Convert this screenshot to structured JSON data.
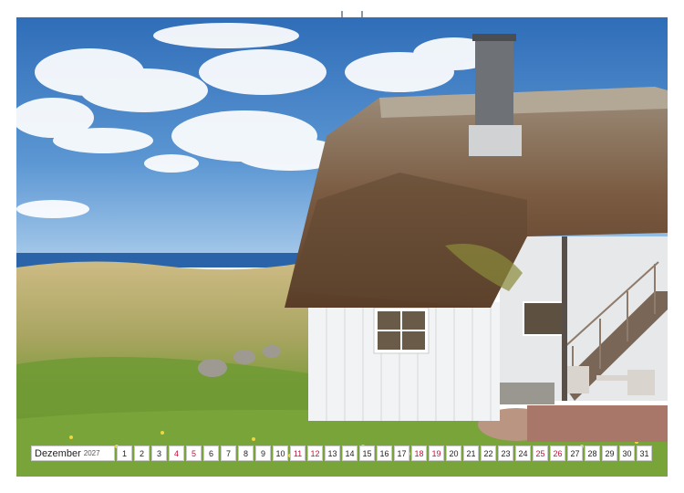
{
  "calendar": {
    "month": "Dezember",
    "year": "2027",
    "days": [
      {
        "n": "1",
        "weekend": false
      },
      {
        "n": "2",
        "weekend": false
      },
      {
        "n": "3",
        "weekend": false
      },
      {
        "n": "4",
        "weekend": true
      },
      {
        "n": "5",
        "weekend": true
      },
      {
        "n": "6",
        "weekend": false
      },
      {
        "n": "7",
        "weekend": false
      },
      {
        "n": "8",
        "weekend": false
      },
      {
        "n": "9",
        "weekend": false
      },
      {
        "n": "10",
        "weekend": false
      },
      {
        "n": "11",
        "weekend": true
      },
      {
        "n": "12",
        "weekend": true
      },
      {
        "n": "13",
        "weekend": false
      },
      {
        "n": "14",
        "weekend": false
      },
      {
        "n": "15",
        "weekend": false
      },
      {
        "n": "16",
        "weekend": false
      },
      {
        "n": "17",
        "weekend": false
      },
      {
        "n": "18",
        "weekend": true
      },
      {
        "n": "19",
        "weekend": true
      },
      {
        "n": "20",
        "weekend": false
      },
      {
        "n": "21",
        "weekend": false
      },
      {
        "n": "22",
        "weekend": false
      },
      {
        "n": "23",
        "weekend": false
      },
      {
        "n": "24",
        "weekend": false
      },
      {
        "n": "25",
        "weekend": true
      },
      {
        "n": "26",
        "weekend": true
      },
      {
        "n": "27",
        "weekend": false
      },
      {
        "n": "28",
        "weekend": false
      },
      {
        "n": "29",
        "weekend": false
      },
      {
        "n": "30",
        "weekend": false
      },
      {
        "n": "31",
        "weekend": false
      }
    ]
  },
  "colors": {
    "weekend": "#c0143c",
    "sky": "#3f7cc4",
    "sea": "#2a63a8",
    "thatch": "#6b4a33",
    "wall": "#f2f3f4",
    "grass": "#7da335"
  }
}
